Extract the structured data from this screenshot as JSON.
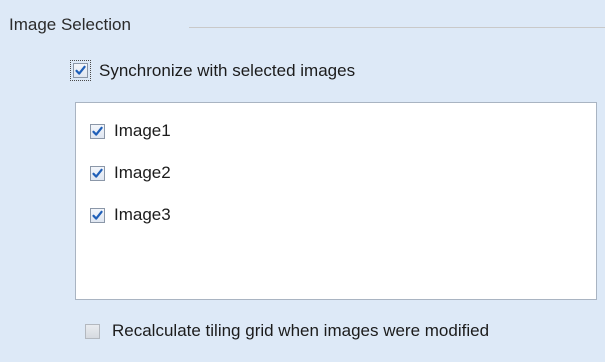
{
  "group": {
    "title": "Image Selection"
  },
  "sync": {
    "label": "Synchronize with selected images",
    "checked": true
  },
  "images": {
    "items": [
      {
        "label": "Image1",
        "checked": true
      },
      {
        "label": "Image2",
        "checked": true
      },
      {
        "label": "Image3",
        "checked": true
      }
    ]
  },
  "recalc": {
    "label": "Recalculate tiling grid when images were modified",
    "checked": false,
    "enabled": false
  },
  "colors": {
    "check_mark": "#1f5fb8",
    "background": "#dde9f7",
    "list_background": "#ffffff"
  },
  "icons": {
    "checkbox_checked": "checkmark-icon"
  }
}
